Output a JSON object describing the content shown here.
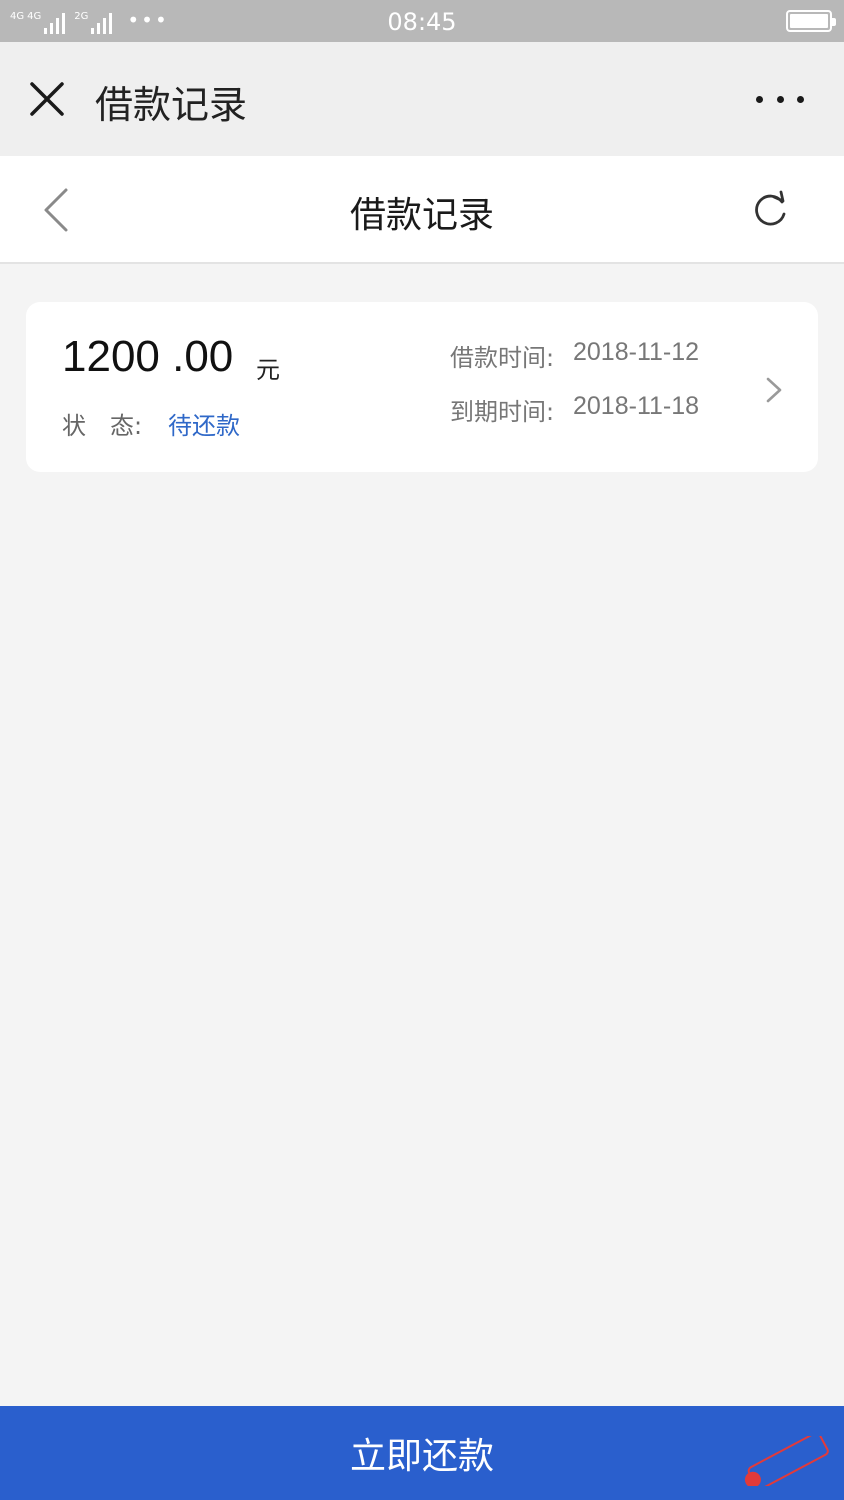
{
  "status_bar": {
    "network_1": "4G",
    "network_2": "4G",
    "network_3": "2G",
    "time": "08:45",
    "more": "•••"
  },
  "app_header": {
    "title": "借款记录",
    "close_icon": "close-icon",
    "more_icon": "more-dots-icon"
  },
  "page_nav": {
    "title": "借款记录",
    "back_icon": "chevron-left-icon",
    "refresh_icon": "refresh-icon"
  },
  "loan": {
    "amount": "1200 .00",
    "unit": "元",
    "status_label": "状　态:",
    "status_value": "待还款",
    "loan_date_label": "借款时间:",
    "loan_date": "2018-11-12",
    "due_date_label": "到期时间:",
    "due_date": "2018-11-18"
  },
  "footer": {
    "repay_label": "立即还款"
  },
  "colors": {
    "accent": "#2a5fcd",
    "status_value": "#2f68c8",
    "background": "#f4f4f4"
  }
}
